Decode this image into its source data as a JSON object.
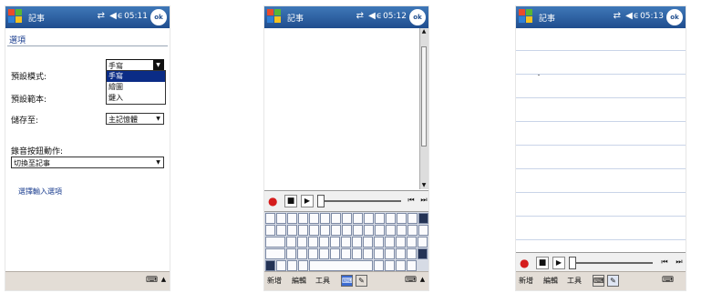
{
  "screens": [
    {
      "title": "記事",
      "time": "05:11",
      "ok_label": "ok",
      "options_header": "選項",
      "default_mode_label": "預設模式:",
      "default_mode_value": "手寫",
      "dropdown_options": [
        "手寫",
        "繪圖",
        "鍵入"
      ],
      "dropdown_selected_index": 0,
      "default_template_label": "預設範本:",
      "save_to_label": "儲存至:",
      "save_to_value": "主記憶體",
      "record_button_action_label": "錄音按鈕動作:",
      "record_button_action_value": "切換至記事",
      "input_options_link": "選擇輸入選項"
    },
    {
      "title": "記事",
      "time": "05:12",
      "ok_label": "ok",
      "menu_items": [
        "新增",
        "編輯",
        "工具"
      ]
    },
    {
      "title": "記事",
      "time": "05:13",
      "ok_label": "ok",
      "menu_items": [
        "新增",
        "編輯",
        "工具"
      ]
    }
  ],
  "icons": {
    "sys": "⇄ ◀ϵ",
    "keyboard": "⌨",
    "up_arrow": "▲",
    "down_arrow": "▼",
    "record": "●",
    "stop": "■",
    "play": "▶",
    "rewind": "⏮",
    "forward": "⏭",
    "pen": "✎",
    "keyboard_mode": "⌨"
  },
  "colors": {
    "titlebar": "#1f4d8e",
    "selection": "#0b2c86",
    "record": "#d51c1c"
  }
}
